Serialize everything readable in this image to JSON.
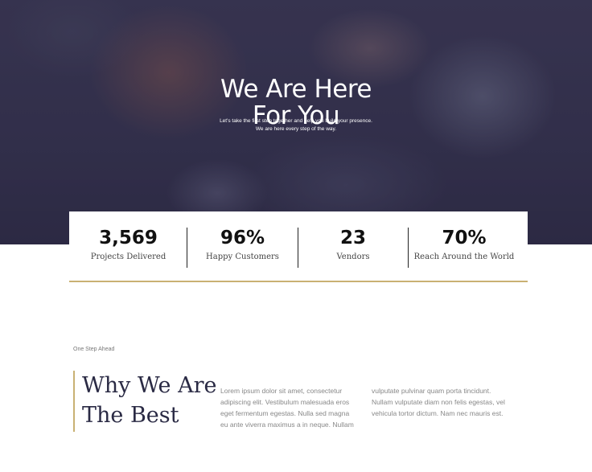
{
  "hero": {
    "title_lines": [
      "We Are Here",
      "For You"
    ],
    "subtitle_lines": [
      "Let's take the first step together and help you build your presence.",
      "We are here every step of the way."
    ]
  },
  "stats": [
    {
      "value": "3,569",
      "label": "Projects Delivered"
    },
    {
      "value": "96%",
      "label": "Happy Customers"
    },
    {
      "value": "23",
      "label": "Vendors"
    },
    {
      "value": "70%",
      "label": "Reach Around the World"
    }
  ],
  "section": {
    "eyebrow": "One Step Ahead",
    "title_lines": [
      "Why We Are",
      "The Best"
    ],
    "col1_lines": [
      "Lorem ipsum dolor sit amet, consectetur",
      "adipiscing elit. Vestibulum malesuada eros",
      "eget fermentum egestas. Nulla sed magna",
      "eu ante viverra maximus a in neque. Nullam"
    ],
    "col2_lines": [
      "vulputate pulvinar quam porta tincidunt.",
      "Nullam vulputate diam non felis egestas, vel",
      "vehicula tortor dictum. Nam nec mauris est."
    ]
  },
  "colors": {
    "accent": "#c9b173",
    "hero_overlay": "#3a3852",
    "title_text": "#2a2a44"
  }
}
